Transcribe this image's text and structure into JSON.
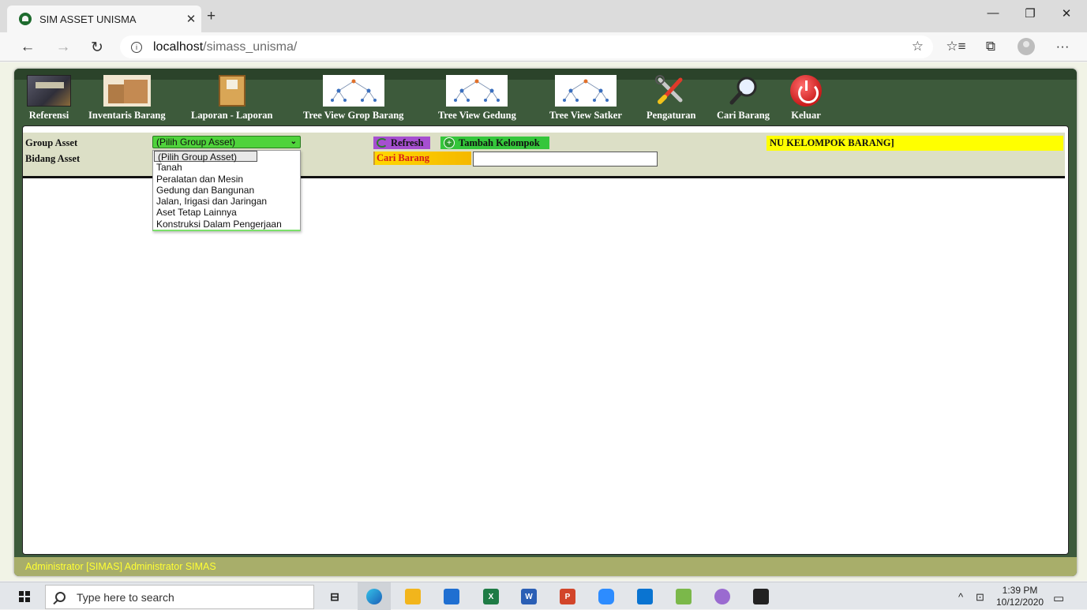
{
  "browser": {
    "tab_title": "SIM ASSET UNISMA",
    "tab_close": "✕",
    "new_tab": "+",
    "url_host": "localhost",
    "url_path": "/simass_unisma/",
    "window_controls": {
      "minimize": "—",
      "maximize": "❐",
      "close": "✕"
    },
    "nav": {
      "back": "←",
      "forward": "→",
      "refresh": "↻"
    },
    "toolbar": {
      "favorite": "☆",
      "favorites_list": "☆≡",
      "collections": "⧉",
      "more": "···"
    }
  },
  "menu": [
    {
      "label": "Referensi",
      "icon": "inventory-management-icon"
    },
    {
      "label": "Inventaris Barang",
      "icon": "boxes-icon"
    },
    {
      "label": "Laporan - Laporan",
      "icon": "file-cabinet-icon"
    },
    {
      "label": "Tree View Grop Barang",
      "icon": "tree-diagram-icon"
    },
    {
      "label": "Tree View Gedung",
      "icon": "tree-diagram-icon"
    },
    {
      "label": "Tree View Satker",
      "icon": "tree-diagram-icon"
    },
    {
      "label": "Pengaturan",
      "icon": "tools-icon"
    },
    {
      "label": "Cari Barang",
      "icon": "magnifier-icon"
    },
    {
      "label": "Keluar",
      "icon": "power-icon"
    }
  ],
  "form": {
    "group_label": "Group Asset",
    "bidang_label": "Bidang Asset",
    "group_selected": "(Pilih Group Asset)",
    "group_options": [
      "(Pilih Group Asset)",
      "Tanah",
      "Peralatan dan Mesin",
      "Gedung dan Bangunan",
      "Jalan, Irigasi dan Jaringan",
      "Aset Tetap Lainnya",
      "Konstruksi Dalam Pengerjaan"
    ],
    "refresh_label": "Refresh",
    "tambah_label": "Tambah Kelompok",
    "cari_label": "Cari Barang",
    "cari_value": "",
    "banner_text": "NU KELOMPOK BARANG]"
  },
  "footer": {
    "user_text": "Administrator [SIMAS] Administrator SIMAS"
  },
  "taskbar": {
    "search_placeholder": "Type here to search",
    "time": "1:39 PM",
    "date": "10/12/2020"
  },
  "colors": {
    "app_frame": "#3d5a3b",
    "select_bg": "#4fd33b",
    "refresh_bg": "#a64fd0",
    "tambah_bg": "#35c63b",
    "cari_bg": "#ffd700",
    "banner_bg": "#ffff00",
    "footer_bg": "#a8ae6a",
    "footer_text": "#ffff33"
  }
}
